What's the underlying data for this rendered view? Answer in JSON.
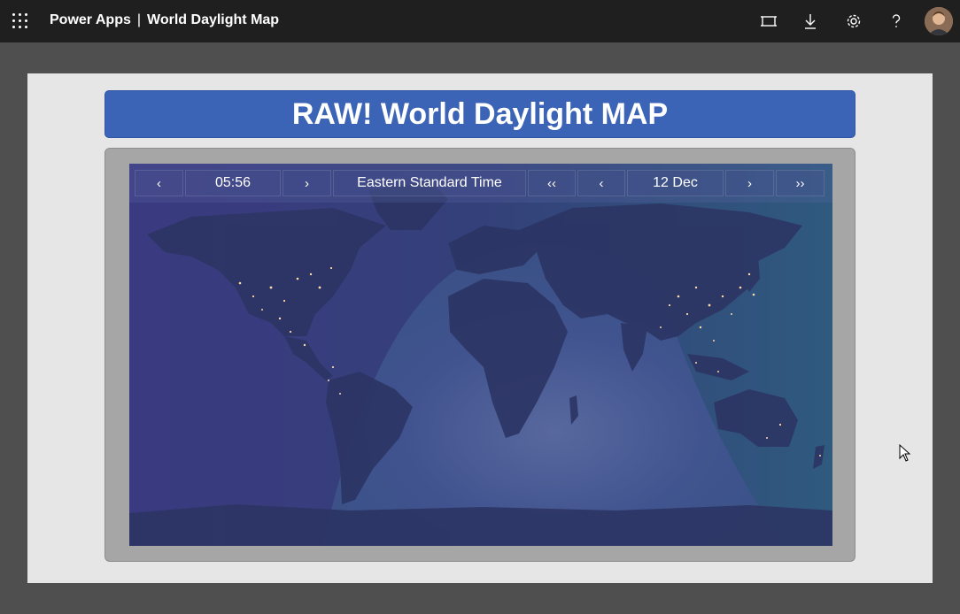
{
  "app": {
    "product": "Power Apps",
    "separator": "|",
    "name": "World Daylight Map"
  },
  "topbar_icons": [
    "fit-to-screen-icon",
    "download-icon",
    "settings-gear-icon",
    "help-icon"
  ],
  "banner": {
    "title": "RAW! World Daylight MAP"
  },
  "controls": {
    "prev_time": "‹",
    "time": "05:56",
    "next_time": "›",
    "timezone": "Eastern Standard Time",
    "prev_month": "‹‹",
    "prev_day": "‹",
    "date": "12 Dec",
    "next_day": "›",
    "next_month": "››"
  },
  "colors": {
    "topbar": "#1f1f1f",
    "banner": "#3b63b6",
    "night": "#2e3566",
    "day": "#3d5a96",
    "land_night": "#283058",
    "city_lights": "#ffd9a8"
  }
}
